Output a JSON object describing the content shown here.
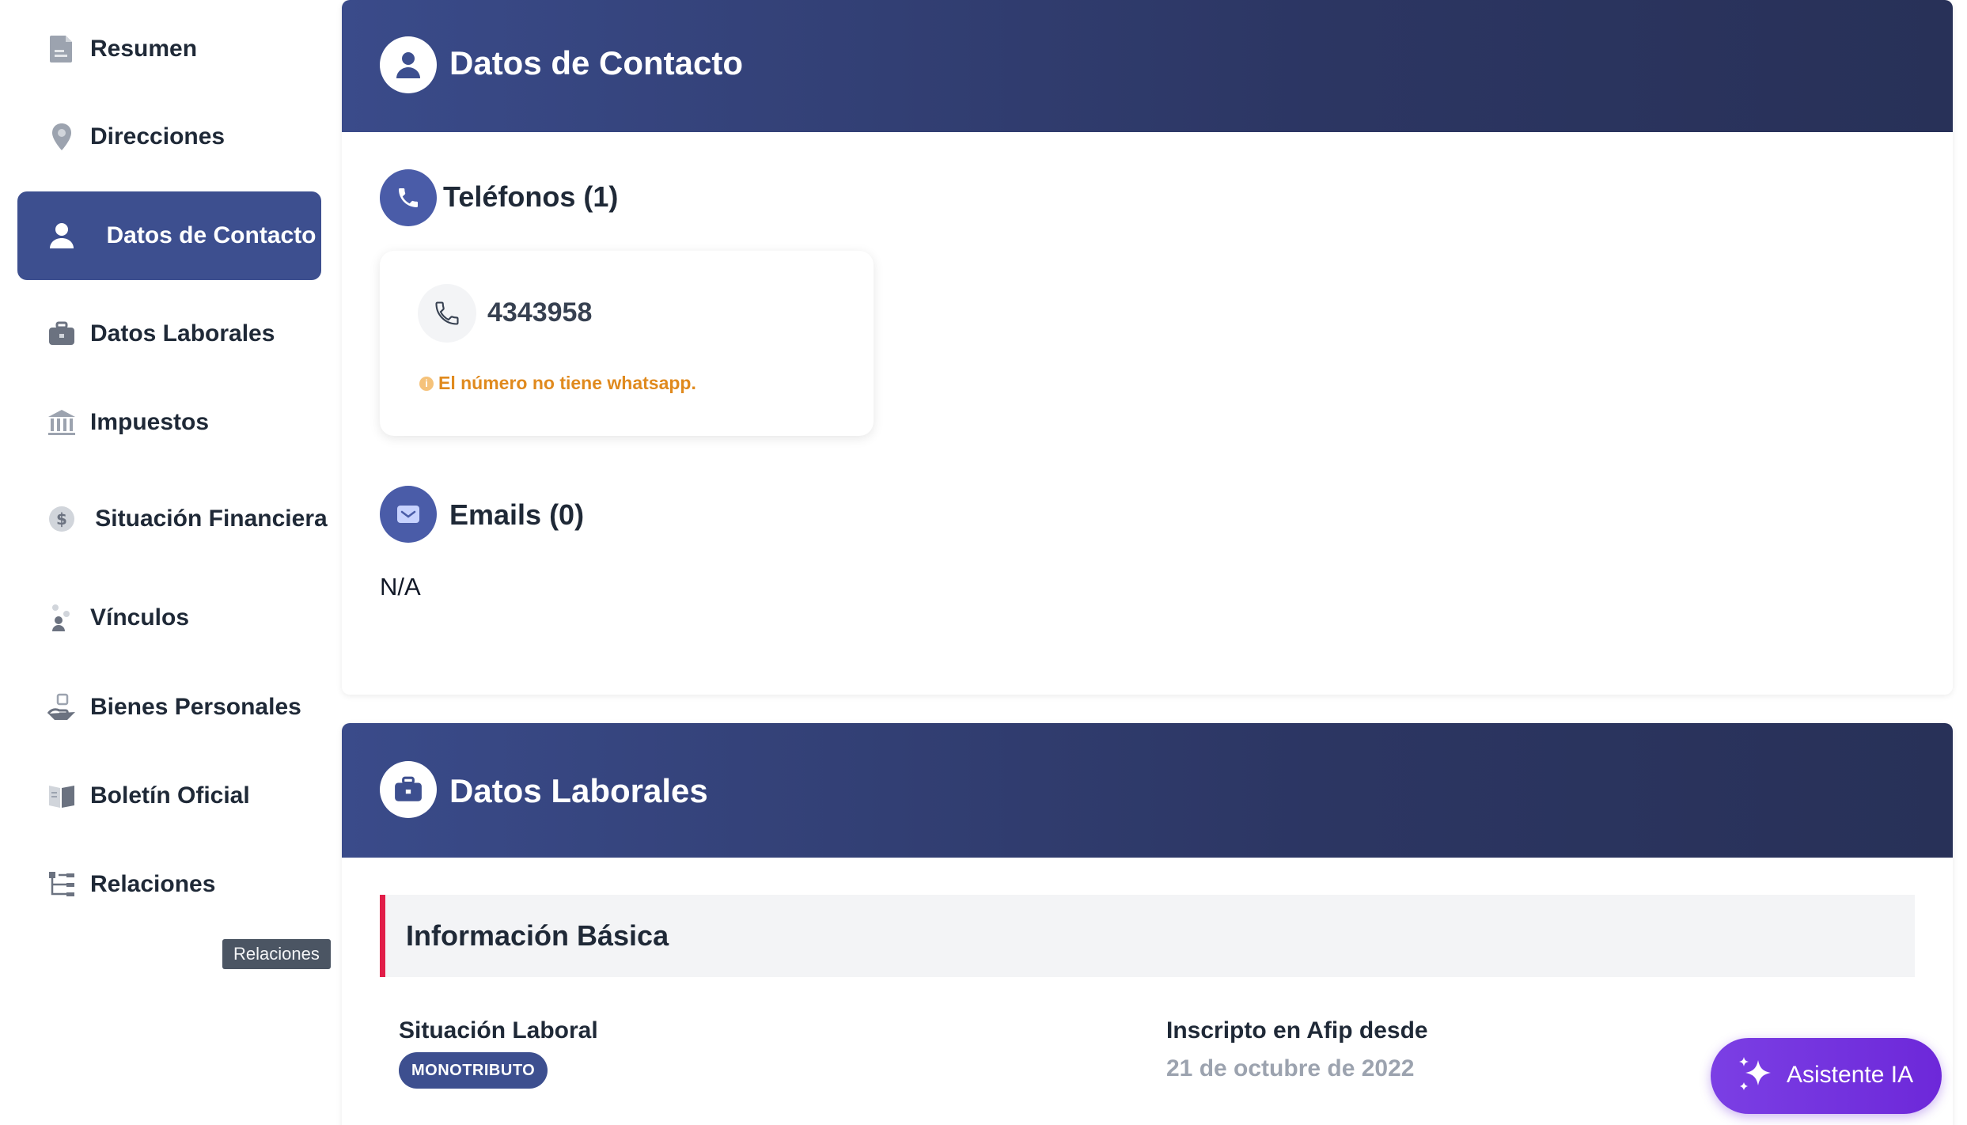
{
  "sidebar": {
    "items": [
      {
        "label": "Resumen",
        "icon": "document-icon"
      },
      {
        "label": "Direcciones",
        "icon": "location-pin-icon"
      },
      {
        "label": "Datos de Contacto",
        "icon": "user-icon",
        "active": true
      },
      {
        "label": "Datos Laborales",
        "icon": "briefcase-icon"
      },
      {
        "label": "Impuestos",
        "icon": "bank-icon"
      },
      {
        "label": "Situación Financiera",
        "icon": "dollar-icon"
      },
      {
        "label": "Vínculos",
        "icon": "people-icon"
      },
      {
        "label": "Bienes Personales",
        "icon": "hand-coin-icon"
      },
      {
        "label": "Boletín Oficial",
        "icon": "book-icon"
      },
      {
        "label": "Relaciones",
        "icon": "hierarchy-icon"
      }
    ],
    "tooltip": "Relaciones"
  },
  "contact_card": {
    "title": "Datos de Contacto",
    "phones_title": "Teléfonos (1)",
    "phones": [
      {
        "number": "4343958",
        "note": "El número no tiene whatsapp."
      }
    ],
    "emails_title": "Emails (0)",
    "emails_empty": "N/A"
  },
  "work_card": {
    "title": "Datos Laborales",
    "section_title": "Información Básica",
    "situacion_label": "Situación Laboral",
    "situacion_badge": "MONOTRIBUTO",
    "afip_label": "Inscripto en Afip desde",
    "afip_value": "21 de octubre de 2022"
  },
  "ai_button": {
    "label": "Asistente IA"
  },
  "colors": {
    "primary": "#3d4f8f",
    "header_dark": "#283158",
    "accent_red": "#e11d48",
    "warning_orange": "#e08a1e",
    "ai_purple": "#6d28d9"
  }
}
